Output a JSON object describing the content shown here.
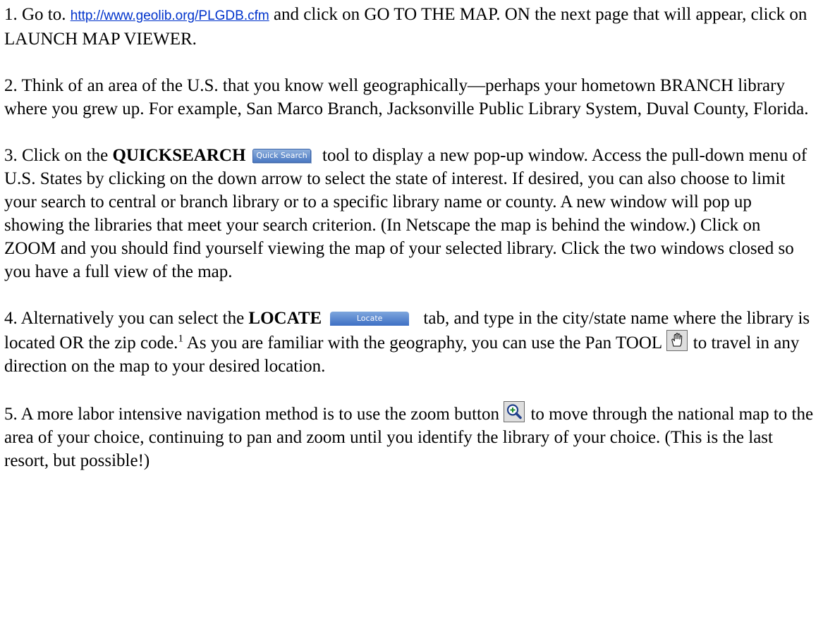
{
  "steps": [
    {
      "num": "1.",
      "pre": " Go to. ",
      "link": "http://www.geolib.org/PLGDB.cfm",
      "post": " and click on GO TO THE MAP.  ON the next page that will appear, click on LAUNCH MAP VIEWER."
    },
    {
      "num": "2.",
      "text": " Think of an area of the U.S. that you know well geographically—perhaps your hometown BRANCH library where you grew up.  For example, San Marco Branch, Jacksonville Public Library System, Duval County, Florida."
    },
    {
      "num": "3.",
      "pre": " Click on the ",
      "bold": "QUICKSEARCH",
      "button": "Quick Search",
      "post": " tool to display a new pop-up window. Access the pull-down menu of U.S. States by clicking on the down arrow to select the state of interest.  If desired, you can also choose to limit your search to central or branch library or to a specific library name or county.  A new window will pop up showing the libraries that meet your search criterion. (In Netscape the map is behind the window.) Click on ZOOM and you should find yourself viewing the map of your selected library. Click the two windows closed so you have a full view of the map."
    },
    {
      "num": "4.",
      "pre": " Alternatively you can select the ",
      "bold": "LOCATE",
      "button": "Locate",
      "mid": " tab, and type in the city/state name where the library is located OR the zip code.",
      "footnote": "1",
      "mid2": "  As you are familiar with the geography, you can use the Pan TOOL ",
      "icon": "pan-hand-icon",
      "post": " to travel in any direction on the map to your desired location."
    },
    {
      "num": "5.",
      "pre": " A more labor intensive navigation method is to use the zoom button ",
      "icon": "zoom-in-icon",
      "post": "  to move through the national map to the area of your choice, continuing to pan and zoom until you identify the library of your choice.  (This is the last resort, but possible!)"
    }
  ],
  "colors": {
    "link": "#0033cc",
    "button_blue": "#4a78c2"
  }
}
